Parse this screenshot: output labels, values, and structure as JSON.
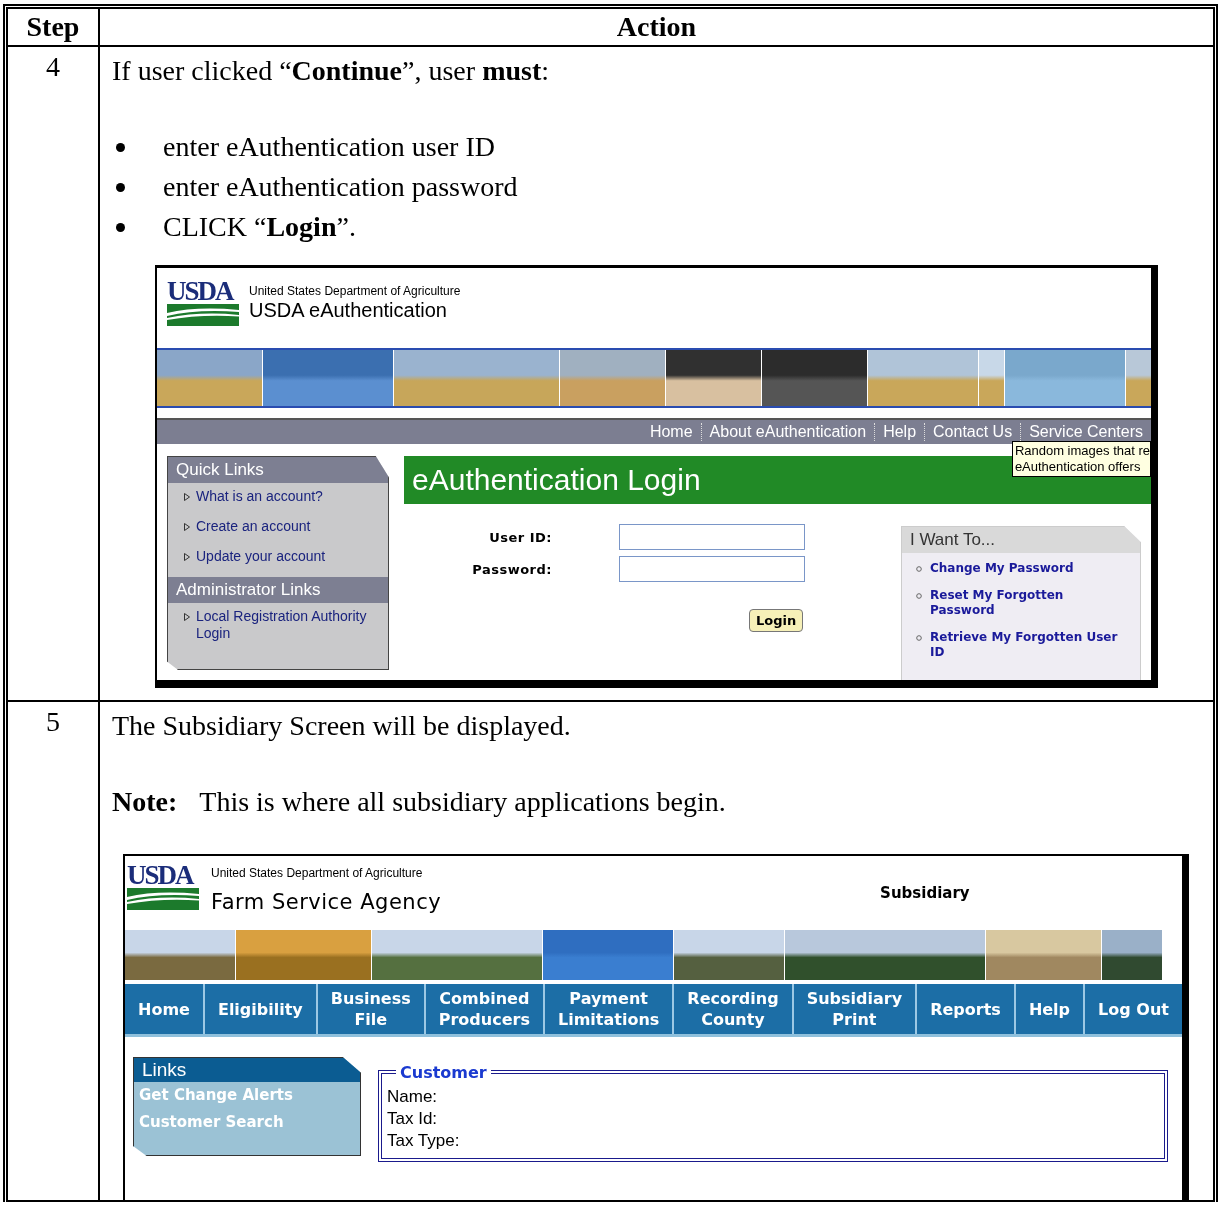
{
  "table": {
    "columns": [
      "Step",
      "Action"
    ],
    "rows": [
      {
        "step": "4",
        "intro": "If user clicked “**Continue**”, user **must**:",
        "bullets": [
          "enter eAuthentication user ID",
          "enter eAuthentication password",
          "CLICK “**Login**”."
        ],
        "screenshot": {
          "kind": "eauth",
          "logo": "USDA",
          "agency": "United States Department of Agriculture",
          "title": "USDA eAuthentication",
          "nav": [
            "Home",
            "About eAuthentication",
            "Help",
            "Contact Us",
            "Service Centers"
          ],
          "tooltip": [
            "Random images that re",
            "eAuthentication offers"
          ],
          "link_groups": [
            {
              "title": "Quick Links",
              "items": [
                "What is an account?",
                "Create an account",
                "Update your account"
              ]
            },
            {
              "title": "Administrator Links",
              "items": [
                "Local Registration Authority Login"
              ]
            }
          ],
          "login_title": "eAuthentication Login",
          "fields": [
            {
              "label": "User ID:"
            },
            {
              "label": "Password:"
            }
          ],
          "button": "Login",
          "want_to": {
            "title": "I Want To...",
            "items": [
              "Change My Password",
              "Reset My Forgotten Password",
              "Retrieve My Forgotten User ID"
            ]
          }
        }
      },
      {
        "step": "5",
        "intro": "The Subsidiary Screen will be displayed.",
        "note": {
          "label": "Note:",
          "text": "This is where all subsidiary applications begin."
        },
        "screenshot": {
          "kind": "fsa",
          "logo": "USDA",
          "agency": "United States Department of Agriculture",
          "title": "Farm Service Agency",
          "page_label": "Subsidiary",
          "nav": [
            [
              "Home"
            ],
            [
              "Eligibility"
            ],
            [
              "Business",
              "File"
            ],
            [
              "Combined",
              "Producers"
            ],
            [
              "Payment",
              "Limitations"
            ],
            [
              "Recording",
              "County"
            ],
            [
              "Subsidiary",
              "Print"
            ],
            [
              "Reports"
            ],
            [
              "Help"
            ],
            [
              "Log Out"
            ]
          ],
          "links": {
            "title": "Links",
            "items": [
              "Get Change Alerts",
              "Customer Search"
            ]
          },
          "customer": {
            "legend": "Customer",
            "fields": [
              "Name:",
              "Tax Id:",
              "Tax Type:"
            ]
          }
        }
      }
    ]
  }
}
